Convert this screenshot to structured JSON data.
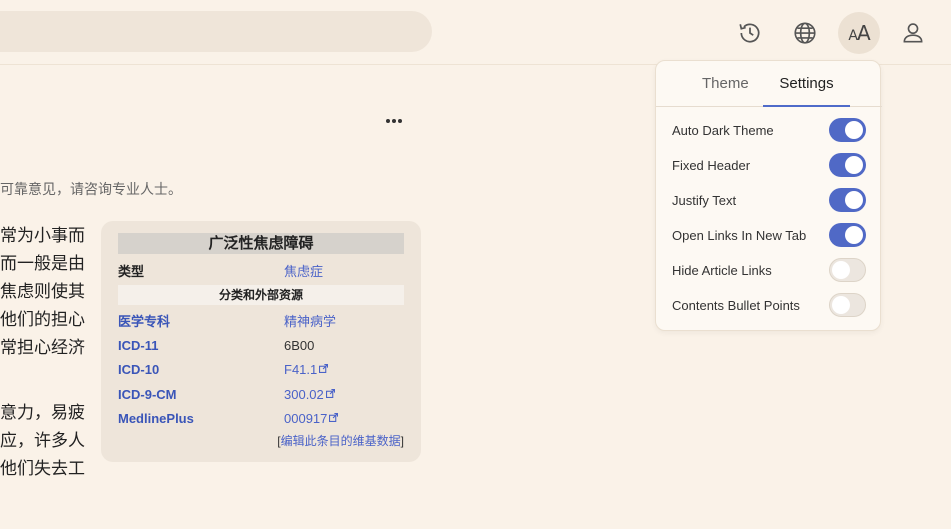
{
  "header": {
    "icons": [
      "history-icon",
      "globe-icon",
      "font-size-icon",
      "user-icon"
    ],
    "aa_label_small": "A",
    "aa_label_big": "A"
  },
  "article": {
    "notice": "可靠意见，请咨询专业人士。",
    "para1": [
      "常为小事而",
      "而一般是由",
      "焦虑则使其",
      "他们的担心",
      "常担心经济"
    ],
    "para2": [
      "意力，易疲",
      "应，许多人",
      "他们失去工"
    ]
  },
  "infobox": {
    "title": "广泛性焦虑障碍",
    "type_label": "类型",
    "type_value": "焦虑症",
    "section": "分类和外部资源",
    "rows": [
      {
        "k": "医学专科",
        "v": "精神病学"
      },
      {
        "k": "ICD-11",
        "v": "6B00"
      },
      {
        "k": "ICD-10",
        "v": "F41.1"
      },
      {
        "k": "ICD-9-CM",
        "v": "300.02"
      },
      {
        "k": "MedlinePlus",
        "v": "000917"
      }
    ],
    "edit_open": "[",
    "edit_link": "编辑此条目的维基数据",
    "edit_close": "]"
  },
  "settings_panel": {
    "tabs": {
      "theme": "Theme",
      "settings": "Settings"
    },
    "options": [
      {
        "label": "Auto Dark Theme",
        "on": true
      },
      {
        "label": "Fixed Header",
        "on": true
      },
      {
        "label": "Justify Text",
        "on": true
      },
      {
        "label": "Open Links In New Tab",
        "on": true
      },
      {
        "label": "Hide Article Links",
        "on": false
      },
      {
        "label": "Contents Bullet Points",
        "on": false
      }
    ]
  },
  "colors": {
    "accent": "#5069c6",
    "background": "#faf2e8",
    "link": "#4a62c8"
  }
}
